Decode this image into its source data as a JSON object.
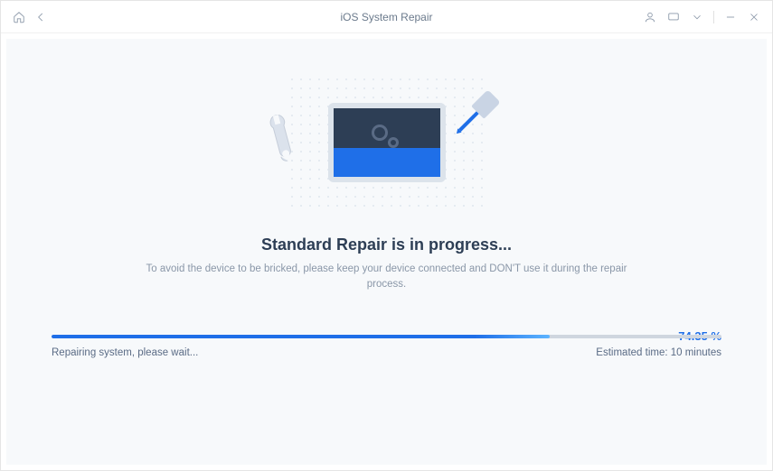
{
  "titlebar": {
    "title": "iOS System Repair"
  },
  "main": {
    "heading": "Standard Repair is in progress...",
    "subtext": "To avoid the device to be bricked, please keep your device connected and DON'T use it during the repair process."
  },
  "progress": {
    "percent_value": 74.35,
    "percent_label": "74.35 %",
    "status_text": "Repairing system, please wait...",
    "eta_text": "Estimated time: 10 minutes"
  }
}
